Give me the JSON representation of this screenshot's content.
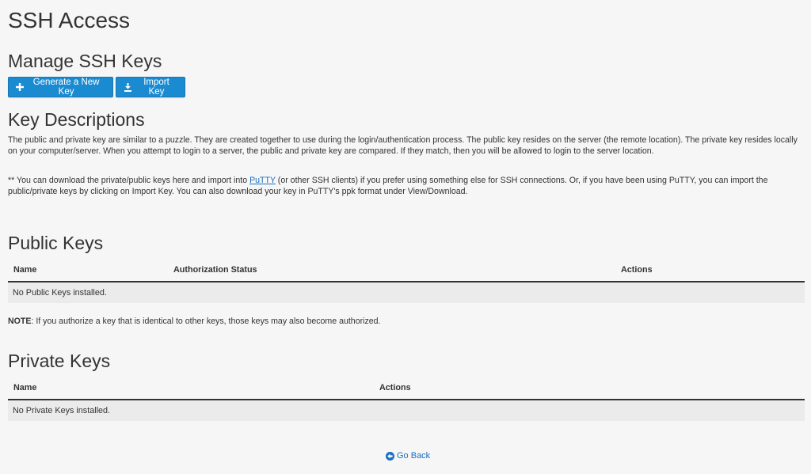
{
  "page": {
    "title": "SSH Access"
  },
  "manage": {
    "title": "Manage SSH Keys",
    "generate_label": "Generate a New Key",
    "import_label": "Import Key"
  },
  "descriptions": {
    "title": "Key Descriptions",
    "paragraph1": "The public and private key are similar to a puzzle. They are created together to use during the login/authentication process. The public key resides on the server (the remote location). The private key resides locally on your computer/server. When you attempt to login to a server, the public and private key are compared. If they match, then you will be allowed to login to the server location.",
    "paragraph2_prefix": "** You can download the private/public keys here and import into ",
    "paragraph2_link": "PuTTY",
    "paragraph2_suffix": " (or other SSH clients) if you prefer using something else for SSH connections. Or, if you have been using PuTTY, you can import the public/private keys by clicking on Import Key. You can also download your key in PuTTY's ppk format under View/Download."
  },
  "public_keys": {
    "title": "Public Keys",
    "columns": [
      "Name",
      "Authorization Status",
      "Actions"
    ],
    "empty_message": "No Public Keys installed."
  },
  "note": {
    "label": "NOTE",
    "text": ": If you authorize a key that is identical to other keys, those keys may also become authorized."
  },
  "private_keys": {
    "title": "Private Keys",
    "columns": [
      "Name",
      "Actions"
    ],
    "empty_message": "No Private Keys installed."
  },
  "footer": {
    "go_back_label": "Go Back"
  },
  "colors": {
    "button_bg": "#1b8bd1",
    "link": "#1b6ec2",
    "page_bg": "#f6f6f6",
    "row_bg": "#ebebeb"
  },
  "icons": {
    "generate": "plus-icon",
    "import": "import-icon",
    "go_back": "arrow-circle-left-icon"
  }
}
